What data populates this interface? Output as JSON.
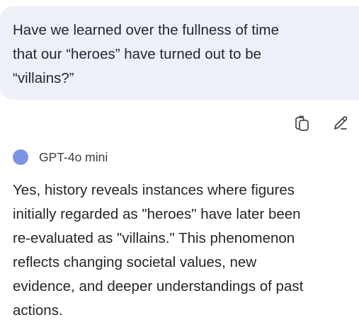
{
  "user_message": {
    "text": "Have we learned over the fullness of time\nthat our “heroes” have turned out to be\n“villains?”"
  },
  "actions": {
    "copy_icon": "copy-icon",
    "edit_icon": "edit-pencil-icon"
  },
  "assistant": {
    "model_name": "GPT-4o mini",
    "avatar_color": "#7b93e6",
    "response": "Yes, history reveals instances where figures\ninitially regarded as \"heroes\" have later been\nre-evaluated as \"villains.\" This phenomenon\nreflects changing societal values, new\nevidence, and deeper understandings of past\nactions."
  }
}
